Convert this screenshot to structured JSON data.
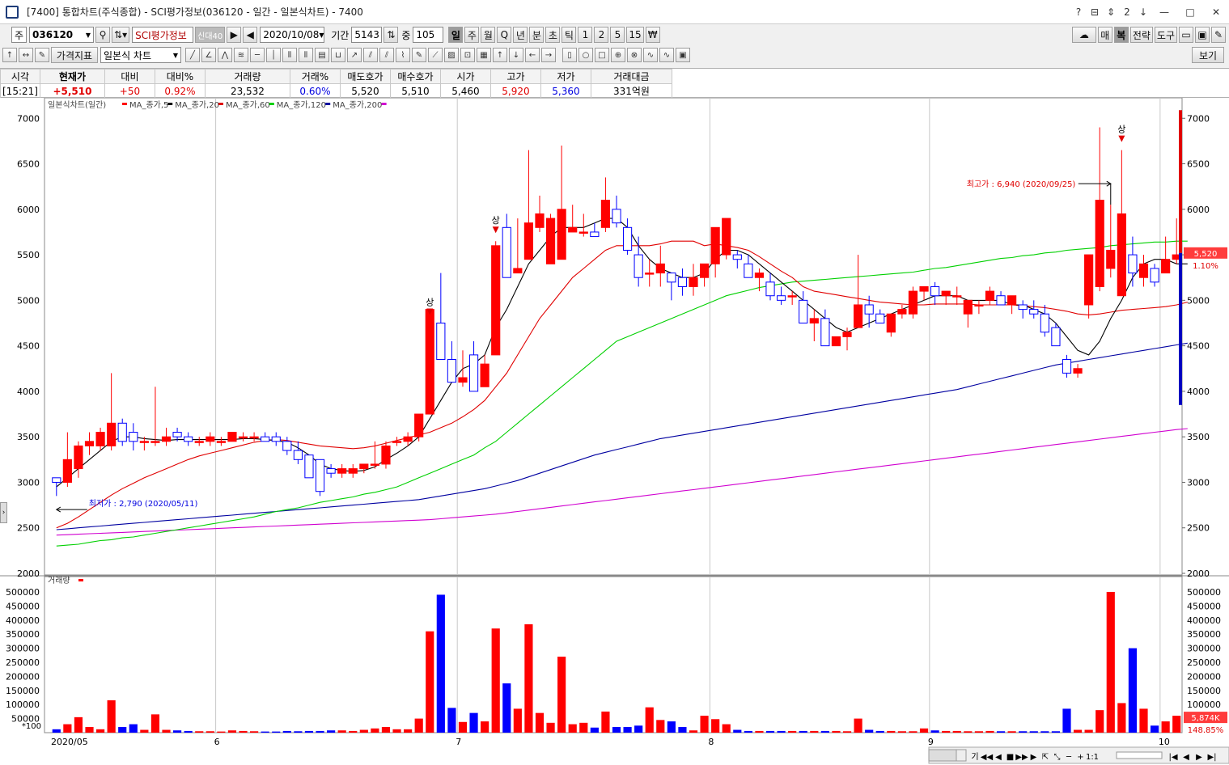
{
  "window": {
    "title": "[7400] 통합차트(주식종합) - SCI평가정보(036120 - 일간 - 일본식차트) - 7400",
    "controls": [
      "?",
      "⊟",
      "⇕",
      "2",
      "↓"
    ]
  },
  "toolbar1": {
    "market": "주",
    "code": "036120",
    "name": "SCI평가정보",
    "badge": "신대40",
    "date": "2020/10/08",
    "period_label": "기간",
    "period_value": "5143",
    "count_label": "중",
    "count_value": "105",
    "intervals": [
      "일",
      "주",
      "월",
      "Q",
      "년",
      "분",
      "초",
      "틱",
      "1",
      "2",
      "5",
      "15",
      "₩"
    ],
    "selected_interval": "일",
    "right_buttons": [
      "매",
      "복",
      "전략",
      "도구"
    ]
  },
  "toolbar2": {
    "indicator_button": "가격지표",
    "chart_type": "일본식 차트",
    "view_button": "보기"
  },
  "quote": {
    "headers": [
      "시각",
      "현재가",
      "대비",
      "대비%",
      "거래량",
      "거래%",
      "매도호가",
      "매수호가",
      "시가",
      "고가",
      "저가",
      "거래대금"
    ],
    "values": [
      "[15:21]",
      "+5,510",
      "+50",
      "0.92%",
      "23,532",
      "0.60%",
      "5,520",
      "5,510",
      "5,460",
      "5,920",
      "5,360",
      "331억원"
    ]
  },
  "colors": {
    "up": "#ff0000",
    "down": "#0000ff",
    "ma5": "#000000",
    "ma20": "#e00000",
    "ma60": "#00d000",
    "ma120": "#0000a0",
    "ma200": "#d000d0"
  },
  "chart_data": {
    "type": "candlestick",
    "title": "일본식차트(일간)",
    "legend": [
      "MA_종가,5",
      "MA_종가,20",
      "MA_종가,60",
      "MA_종가,120",
      "MA_종가,200"
    ],
    "ylim": [
      2000,
      7100
    ],
    "yticks": [
      2000,
      2500,
      3000,
      3500,
      4000,
      4500,
      5000,
      5500,
      6000,
      6500,
      7000
    ],
    "x_month_labels": [
      {
        "label": "2020/05",
        "index": 0
      },
      {
        "label": "6",
        "index": 15
      },
      {
        "label": "7",
        "index": 37
      },
      {
        "label": "8",
        "index": 60
      },
      {
        "label": "9",
        "index": 80
      },
      {
        "label": "10",
        "index": 101
      }
    ],
    "annotations": {
      "high": "최고가 : 6,940 (2020/09/25)",
      "low": "최저가 : 2,790 (2020/05/11)",
      "limit_up_label": "상",
      "current_price": "5,520",
      "current_pct": "1.10%"
    },
    "candles": [
      [
        3050,
        3050,
        2850,
        3000
      ],
      [
        3000,
        3550,
        2950,
        3250
      ],
      [
        3150,
        3450,
        3050,
        3400
      ],
      [
        3400,
        3550,
        3300,
        3450
      ],
      [
        3400,
        3600,
        3350,
        3550
      ],
      [
        3400,
        4200,
        3350,
        3650
      ],
      [
        3650,
        3700,
        3400,
        3450
      ],
      [
        3550,
        3650,
        3350,
        3450
      ],
      [
        3450,
        3500,
        3350,
        3450
      ],
      [
        3450,
        4050,
        3400,
        3450
      ],
      [
        3450,
        3600,
        3400,
        3500
      ],
      [
        3550,
        3600,
        3450,
        3500
      ],
      [
        3500,
        3550,
        3400,
        3450
      ],
      [
        3450,
        3500,
        3400,
        3450
      ],
      [
        3450,
        3550,
        3400,
        3500
      ],
      [
        3450,
        3500,
        3400,
        3450
      ],
      [
        3450,
        3550,
        3450,
        3550
      ],
      [
        3500,
        3550,
        3450,
        3500
      ],
      [
        3500,
        3550,
        3450,
        3500
      ],
      [
        3500,
        3550,
        3450,
        3450
      ],
      [
        3500,
        3550,
        3400,
        3450
      ],
      [
        3450,
        3500,
        3300,
        3350
      ],
      [
        3350,
        3450,
        3200,
        3250
      ],
      [
        3300,
        3300,
        3050,
        3050
      ],
      [
        3250,
        3250,
        2850,
        2900
      ],
      [
        3150,
        3200,
        3050,
        3100
      ],
      [
        3100,
        3200,
        3050,
        3150
      ],
      [
        3100,
        3200,
        3050,
        3150
      ],
      [
        3150,
        3200,
        3100,
        3200
      ],
      [
        3200,
        3450,
        3150,
        3200
      ],
      [
        3200,
        3450,
        3150,
        3400
      ],
      [
        3450,
        3500,
        3400,
        3450
      ],
      [
        3450,
        3550,
        3400,
        3500
      ],
      [
        3500,
        3600,
        3450,
        3750
      ],
      [
        3750,
        4750,
        3750,
        4900
      ],
      [
        4750,
        5300,
        4750,
        4350
      ],
      [
        4350,
        4550,
        4100,
        4100
      ],
      [
        4100,
        4450,
        4050,
        4150
      ],
      [
        4400,
        4550,
        4000,
        4000
      ],
      [
        4050,
        4400,
        4050,
        4300
      ],
      [
        4400,
        5650,
        4400,
        5600
      ],
      [
        5800,
        5950,
        5250,
        5250
      ],
      [
        5300,
        5900,
        5300,
        5350
      ],
      [
        5450,
        6650,
        5450,
        5850
      ],
      [
        5800,
        6150,
        5750,
        5950
      ],
      [
        5400,
        5950,
        5400,
        5900
      ],
      [
        5450,
        6700,
        5450,
        6000
      ],
      [
        5750,
        6050,
        5750,
        5800
      ],
      [
        5750,
        5950,
        5700,
        5750
      ],
      [
        5750,
        5850,
        5700,
        5700
      ],
      [
        5800,
        6350,
        5750,
        6100
      ],
      [
        6000,
        6150,
        5800,
        5850
      ],
      [
        5800,
        5900,
        5500,
        5550
      ],
      [
        5500,
        5700,
        5150,
        5250
      ],
      [
        5300,
        5450,
        5150,
        5300
      ],
      [
        5300,
        5600,
        5150,
        5400
      ],
      [
        5300,
        5300,
        5000,
        5200
      ],
      [
        5250,
        5350,
        5050,
        5150
      ],
      [
        5150,
        5400,
        5050,
        5250
      ],
      [
        5250,
        5400,
        5150,
        5400
      ],
      [
        5400,
        5550,
        5250,
        5800
      ],
      [
        5500,
        5850,
        5450,
        5900
      ],
      [
        5500,
        5550,
        5350,
        5450
      ],
      [
        5400,
        5500,
        5300,
        5250
      ],
      [
        5250,
        5350,
        5100,
        5300
      ],
      [
        5200,
        5300,
        5000,
        5050
      ],
      [
        5050,
        5150,
        4950,
        5000
      ],
      [
        5050,
        5100,
        4950,
        5050
      ],
      [
        5000,
        5100,
        4800,
        4750
      ],
      [
        4750,
        4900,
        4550,
        4800
      ],
      [
        4800,
        4900,
        4550,
        4500
      ],
      [
        4500,
        4600,
        4500,
        4600
      ],
      [
        4600,
        4700,
        4450,
        4650
      ],
      [
        4700,
        5500,
        4700,
        4950
      ],
      [
        4950,
        5050,
        4700,
        4850
      ],
      [
        4850,
        4900,
        4750,
        4750
      ],
      [
        4650,
        4850,
        4600,
        4850
      ],
      [
        4850,
        4950,
        4800,
        4900
      ],
      [
        4850,
        5150,
        4800,
        5100
      ],
      [
        5100,
        5150,
        5000,
        5150
      ],
      [
        5150,
        5200,
        4950,
        5050
      ],
      [
        5050,
        5050,
        4950,
        5100
      ],
      [
        5050,
        5150,
        4950,
        5050
      ],
      [
        4850,
        4950,
        4700,
        5000
      ],
      [
        4950,
        5000,
        4850,
        4950
      ],
      [
        5000,
        5150,
        4950,
        5100
      ],
      [
        5050,
        5100,
        4950,
        4950
      ],
      [
        4950,
        5050,
        4850,
        5050
      ],
      [
        4950,
        5000,
        4800,
        4900
      ],
      [
        4900,
        5000,
        4800,
        4850
      ],
      [
        4850,
        4950,
        4600,
        4650
      ],
      [
        4700,
        4750,
        4500,
        4500
      ],
      [
        4350,
        4400,
        4150,
        4200
      ],
      [
        4200,
        4300,
        4150,
        4250
      ],
      [
        4950,
        5500,
        4800,
        5500
      ],
      [
        5150,
        6900,
        5100,
        6100
      ],
      [
        5350,
        6050,
        5250,
        5550
      ],
      [
        5050,
        6650,
        5050,
        5950
      ],
      [
        5500,
        5700,
        5150,
        5300
      ],
      [
        5250,
        5500,
        5150,
        5400
      ],
      [
        5350,
        5400,
        5150,
        5200
      ],
      [
        5300,
        5700,
        5300,
        5450
      ],
      [
        5450,
        5900,
        5400,
        5500
      ]
    ],
    "ma5": [
      2950,
      3050,
      3150,
      3250,
      3350,
      3450,
      3500,
      3500,
      3480,
      3470,
      3460,
      3470,
      3470,
      3470,
      3470,
      3470,
      3470,
      3480,
      3480,
      3470,
      3460,
      3440,
      3380,
      3300,
      3200,
      3150,
      3130,
      3120,
      3130,
      3170,
      3250,
      3320,
      3400,
      3500,
      3700,
      3900,
      4100,
      4250,
      4300,
      4400,
      4700,
      4900,
      5150,
      5400,
      5550,
      5700,
      5800,
      5800,
      5800,
      5850,
      5900,
      5900,
      5800,
      5600,
      5450,
      5350,
      5300,
      5250,
      5250,
      5300,
      5450,
      5550,
      5550,
      5500,
      5400,
      5300,
      5200,
      5100,
      5000,
      4900,
      4800,
      4700,
      4650,
      4700,
      4750,
      4800,
      4850,
      4900,
      4950,
      5000,
      5050,
      5050,
      5050,
      5000,
      5000,
      5000,
      5000,
      4950,
      4950,
      4900,
      4850,
      4750,
      4600,
      4450,
      4400,
      4550,
      4800,
      5000,
      5250,
      5400,
      5450,
      5450,
      5400,
      5400
    ],
    "ma20": [
      2500,
      2550,
      2620,
      2700,
      2780,
      2860,
      2930,
      2990,
      3050,
      3100,
      3150,
      3200,
      3250,
      3290,
      3320,
      3350,
      3380,
      3410,
      3440,
      3460,
      3470,
      3460,
      3440,
      3420,
      3400,
      3390,
      3380,
      3370,
      3380,
      3400,
      3430,
      3460,
      3490,
      3520,
      3550,
      3600,
      3650,
      3720,
      3800,
      3900,
      4050,
      4200,
      4400,
      4600,
      4800,
      4950,
      5100,
      5250,
      5350,
      5450,
      5550,
      5600,
      5600,
      5600,
      5600,
      5620,
      5650,
      5650,
      5650,
      5600,
      5620,
      5600,
      5580,
      5550,
      5480,
      5400,
      5320,
      5250,
      5150,
      5100,
      5080,
      5060,
      5040,
      5020,
      5000,
      4980,
      4970,
      4960,
      4950,
      4950,
      4960,
      4960,
      4960,
      4960,
      4950,
      4950,
      4950,
      4950,
      4940,
      4930,
      4920,
      4900,
      4880,
      4850,
      4840,
      4850,
      4870,
      4890,
      4900,
      4910,
      4920,
      4930,
      4950,
      4980
    ],
    "ma60": [
      2300,
      2310,
      2320,
      2340,
      2360,
      2370,
      2390,
      2400,
      2420,
      2440,
      2460,
      2480,
      2500,
      2520,
      2540,
      2560,
      2580,
      2600,
      2620,
      2650,
      2680,
      2700,
      2720,
      2750,
      2780,
      2800,
      2820,
      2840,
      2870,
      2890,
      2920,
      2950,
      3000,
      3050,
      3100,
      3150,
      3200,
      3250,
      3300,
      3380,
      3450,
      3550,
      3650,
      3750,
      3850,
      3950,
      4050,
      4150,
      4250,
      4350,
      4450,
      4550,
      4600,
      4650,
      4700,
      4750,
      4800,
      4850,
      4900,
      4950,
      5000,
      5050,
      5080,
      5110,
      5140,
      5160,
      5180,
      5200,
      5210,
      5220,
      5230,
      5240,
      5250,
      5260,
      5270,
      5280,
      5290,
      5300,
      5310,
      5330,
      5350,
      5360,
      5380,
      5400,
      5420,
      5440,
      5460,
      5470,
      5490,
      5500,
      5520,
      5530,
      5550,
      5560,
      5570,
      5580,
      5600,
      5610,
      5620,
      5630,
      5640,
      5640,
      5650,
      5650
    ],
    "ma120": [
      2480,
      2490,
      2500,
      2510,
      2520,
      2530,
      2540,
      2550,
      2560,
      2570,
      2580,
      2590,
      2600,
      2610,
      2620,
      2630,
      2640,
      2650,
      2660,
      2670,
      2680,
      2690,
      2700,
      2710,
      2720,
      2730,
      2740,
      2750,
      2760,
      2770,
      2780,
      2790,
      2800,
      2810,
      2830,
      2850,
      2870,
      2890,
      2910,
      2930,
      2960,
      2990,
      3020,
      3060,
      3100,
      3140,
      3180,
      3220,
      3260,
      3300,
      3330,
      3360,
      3390,
      3420,
      3450,
      3480,
      3500,
      3520,
      3540,
      3560,
      3580,
      3600,
      3620,
      3640,
      3660,
      3680,
      3700,
      3720,
      3740,
      3760,
      3780,
      3800,
      3820,
      3840,
      3860,
      3880,
      3900,
      3920,
      3940,
      3960,
      3980,
      4000,
      4020,
      4050,
      4080,
      4110,
      4140,
      4170,
      4200,
      4230,
      4260,
      4290,
      4310,
      4330,
      4350,
      4370,
      4390,
      4410,
      4430,
      4450,
      4470,
      4490,
      4510,
      4530
    ],
    "ma200": [
      2420,
      2425,
      2430,
      2435,
      2440,
      2445,
      2450,
      2455,
      2460,
      2465,
      2470,
      2475,
      2480,
      2485,
      2490,
      2495,
      2500,
      2505,
      2510,
      2515,
      2520,
      2525,
      2530,
      2535,
      2540,
      2545,
      2550,
      2555,
      2560,
      2565,
      2570,
      2575,
      2580,
      2585,
      2590,
      2600,
      2610,
      2620,
      2630,
      2640,
      2650,
      2665,
      2680,
      2695,
      2710,
      2725,
      2740,
      2755,
      2770,
      2785,
      2800,
      2815,
      2830,
      2845,
      2860,
      2875,
      2890,
      2905,
      2920,
      2935,
      2950,
      2965,
      2980,
      2995,
      3010,
      3025,
      3040,
      3055,
      3070,
      3085,
      3100,
      3115,
      3130,
      3145,
      3160,
      3175,
      3190,
      3205,
      3220,
      3235,
      3250,
      3265,
      3280,
      3295,
      3310,
      3325,
      3340,
      3355,
      3370,
      3385,
      3400,
      3415,
      3430,
      3445,
      3460,
      3475,
      3490,
      3505,
      3520,
      3535,
      3550,
      3565,
      3580,
      3590
    ],
    "volume": {
      "title": "거래량",
      "ylim": [
        0,
        520000
      ],
      "yticks": [
        0,
        50000,
        100000,
        150000,
        200000,
        250000,
        300000,
        350000,
        400000,
        450000,
        500000
      ],
      "current_label": "5,874K",
      "current_pct": "148.85%",
      "scale_label": "*100",
      "values": [
        12000,
        30000,
        55000,
        20000,
        12000,
        115000,
        20000,
        30000,
        10000,
        65000,
        10000,
        8000,
        6000,
        5000,
        5000,
        4000,
        8000,
        6000,
        5000,
        4000,
        4000,
        6000,
        5000,
        6000,
        6000,
        8000,
        8000,
        6000,
        10000,
        15000,
        20000,
        12000,
        12000,
        50000,
        360000,
        490000,
        88000,
        38000,
        70000,
        40000,
        370000,
        175000,
        85000,
        385000,
        70000,
        35000,
        270000,
        30000,
        35000,
        18000,
        75000,
        20000,
        20000,
        25000,
        90000,
        45000,
        40000,
        20000,
        8000,
        60000,
        48000,
        30000,
        10000,
        6000,
        6000,
        6000,
        6000,
        6000,
        6000,
        6000,
        6000,
        6000,
        5000,
        50000,
        10000,
        6000,
        6000,
        5000,
        5000,
        15000,
        8000,
        6000,
        6000,
        5000,
        5000,
        6000,
        5000,
        5000,
        5000,
        5000,
        5000,
        5000,
        85000,
        10000,
        10000,
        80000,
        500000,
        105000,
        300000,
        85000,
        25000,
        40000,
        60000
      ]
    }
  }
}
